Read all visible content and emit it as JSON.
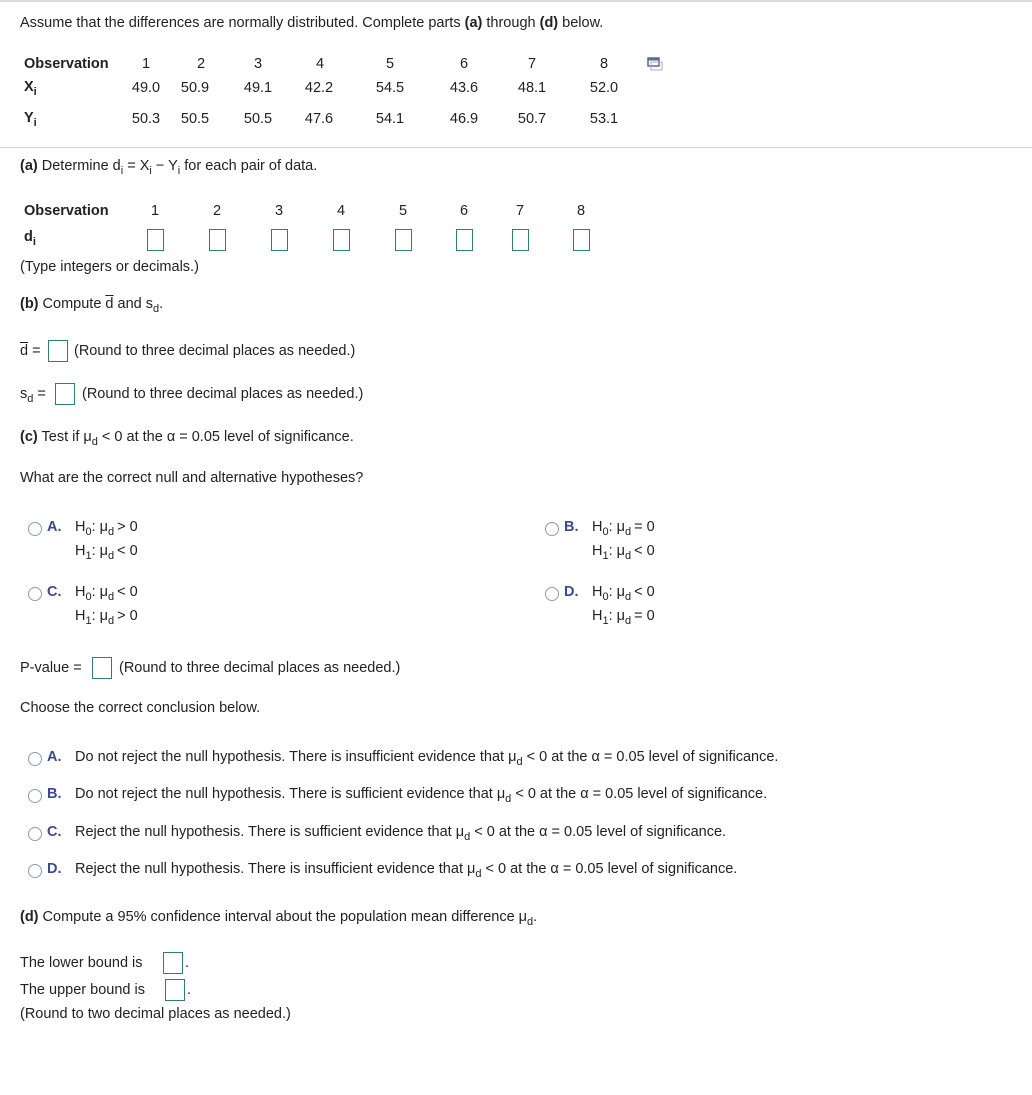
{
  "intro": {
    "text_before": "Assume that the differences are normally distributed. Complete parts ",
    "part_a": "(a)",
    "through": " through ",
    "part_d": "(d)",
    "text_after": " below."
  },
  "data_table": {
    "row_label": "Observation",
    "observations": [
      "1",
      "2",
      "3",
      "4",
      "5",
      "6",
      "7",
      "8"
    ],
    "x_label": "X",
    "x_sub": "i",
    "x_values": [
      "49.0",
      "50.9",
      "49.1",
      "42.2",
      "54.5",
      "43.6",
      "48.1",
      "52.0"
    ],
    "y_label": "Y",
    "y_sub": "i",
    "y_values": [
      "50.3",
      "50.5",
      "50.5",
      "47.6",
      "54.1",
      "46.9",
      "50.7",
      "53.1"
    ],
    "copy_icon": "copy-icon"
  },
  "part_a": {
    "label": "(a)",
    "text1": " Determine d",
    "sub_i": "i",
    "text2": " = X",
    "text3": " − Y",
    "text4": " for each pair of data.",
    "row_label": "Observation",
    "d_label": "d",
    "d_sub": "i",
    "observations": [
      "1",
      "2",
      "3",
      "4",
      "5",
      "6",
      "7",
      "8"
    ],
    "d_values": [
      "",
      "",
      "",
      "",
      "",
      "",
      "",
      ""
    ],
    "hint": "(Type integers or decimals.)"
  },
  "part_b": {
    "label": "(b)",
    "text": " Compute ",
    "d_bar": "d",
    "and": " and s",
    "sub_d": "d",
    "period": ".",
    "dbar_eq": "d",
    "dbar_equals": " =",
    "dbar_value": "",
    "dbar_hint": "(Round to three decimal places as needed.)",
    "sd_label": "s",
    "sd_sub": "d",
    "sd_equals": " =",
    "sd_value": "",
    "sd_hint": "(Round to three decimal places as needed.)"
  },
  "part_c": {
    "label": "(c)",
    "text1": " Test if μ",
    "sub_d": "d",
    "text2": " < 0 at the α = 0.05 level of significance.",
    "question": "What are the correct null and alternative hypotheses?",
    "hypotheses": [
      {
        "letter": "A.",
        "h0": "> 0",
        "h1": "< 0"
      },
      {
        "letter": "B.",
        "h0": "= 0",
        "h1": "< 0"
      },
      {
        "letter": "C.",
        "h0": "< 0",
        "h1": "> 0"
      },
      {
        "letter": "D.",
        "h0": "< 0",
        "h1": "= 0"
      }
    ],
    "h": "H",
    "h0_sub": "0",
    "h1_sub": "1",
    "colon_mu": ": μ",
    "mu_sub": "d",
    "pvalue_label": "P-value =",
    "pvalue_value": "",
    "pvalue_hint": "(Round to three decimal places as needed.)",
    "conclusion_prompt": "Choose the correct conclusion below.",
    "conclusions": [
      {
        "letter": "A.",
        "text1": "Do not reject the null hypothesis. There is insufficient evidence that μ",
        "text2": " < 0 at the α = 0.05 level of significance."
      },
      {
        "letter": "B.",
        "text1": "Do not reject the null hypothesis. There is sufficient evidence that μ",
        "text2": " < 0 at the α = 0.05 level of significance."
      },
      {
        "letter": "C.",
        "text1": "Reject the null hypothesis. There is sufficient evidence that μ",
        "text2": " < 0 at the α = 0.05 level of significance."
      },
      {
        "letter": "D.",
        "text1": "Reject the null hypothesis. There is insufficient evidence that μ",
        "text2": " < 0 at the α = 0.05 level of significance."
      }
    ],
    "conc_sub": "d"
  },
  "part_d": {
    "label": "(d)",
    "text": " Compute a 95% confidence interval about the population mean difference μ",
    "sub_d": "d",
    "period": ".",
    "lower_label": "The lower bound is",
    "lower_value": "",
    "upper_label": "The upper bound is",
    "upper_value": "",
    "dot": ".",
    "hint": "(Round to two decimal places as needed.)"
  },
  "colors": {
    "input_border": "#2e7d7a",
    "option_letter": "#3b4a8c",
    "radio_border": "#8e9ab8",
    "divider": "#d4d4d4"
  }
}
